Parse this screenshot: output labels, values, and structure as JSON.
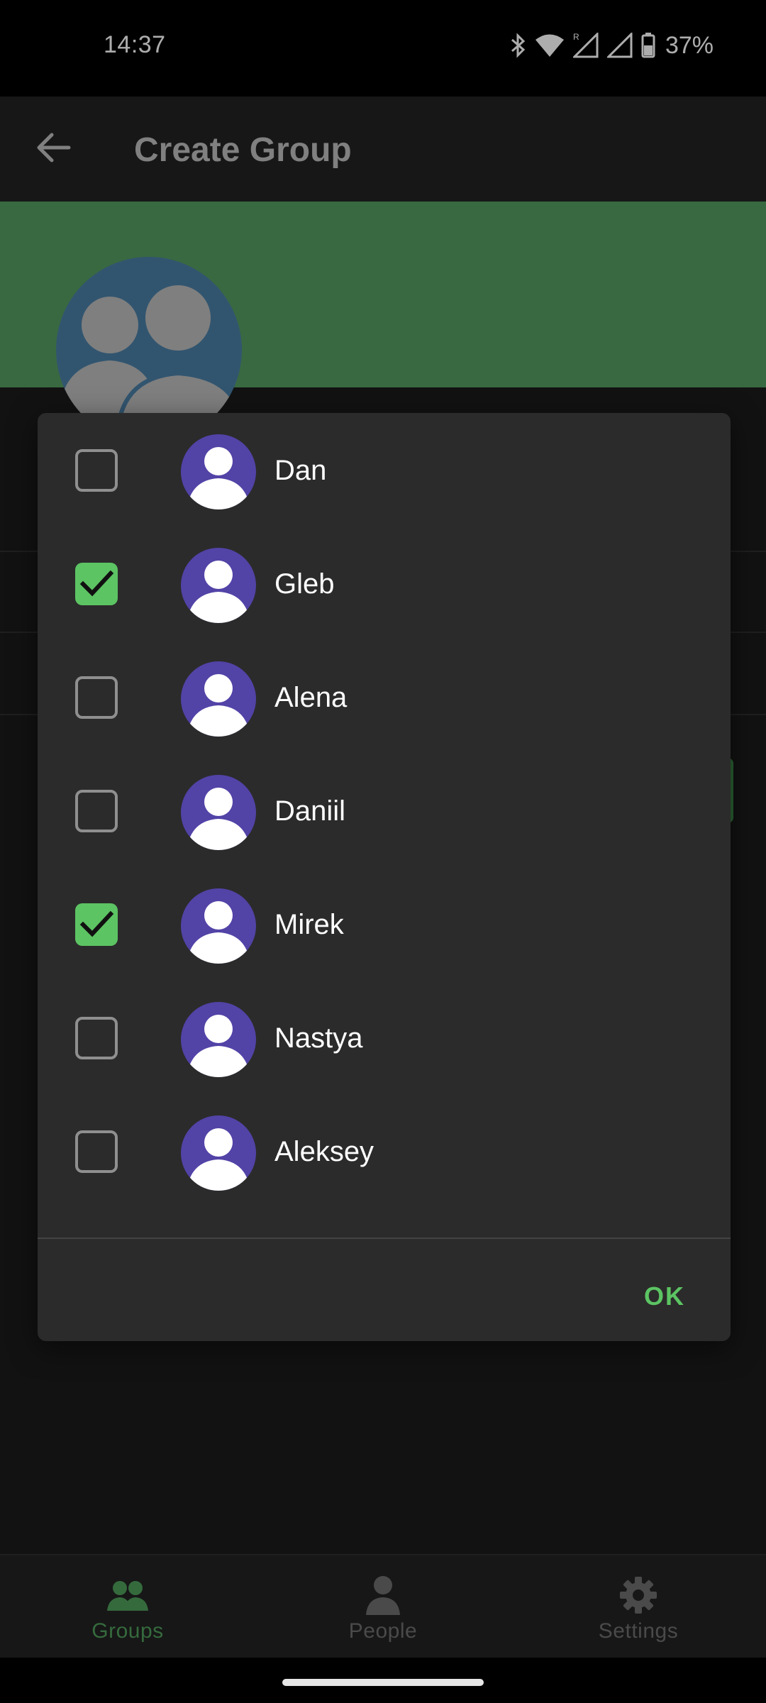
{
  "status_bar": {
    "time": "14:37",
    "battery": "37%",
    "icons": [
      "bluetooth-icon",
      "wifi-icon",
      "signal-icon",
      "signal-icon",
      "battery-icon"
    ]
  },
  "app_bar": {
    "title": "Create Group",
    "back_icon": "arrow-back-icon"
  },
  "header": {
    "color": "#549b60",
    "avatar_color": "#4a7ea4"
  },
  "dialog": {
    "members": [
      {
        "name": "Dan",
        "checked": false
      },
      {
        "name": "Gleb",
        "checked": true
      },
      {
        "name": "Alena",
        "checked": false
      },
      {
        "name": "Daniil",
        "checked": false
      },
      {
        "name": "Mirek",
        "checked": true
      },
      {
        "name": "Nastya",
        "checked": false
      },
      {
        "name": "Aleksey",
        "checked": false
      }
    ],
    "ok_label": "OK",
    "accent": "#5cc463",
    "avatar_color": "#5243a7"
  },
  "bottom_nav": {
    "items": [
      {
        "label": "Groups",
        "icon": "groups-icon",
        "active": true
      },
      {
        "label": "People",
        "icon": "person-icon",
        "active": false
      },
      {
        "label": "Settings",
        "icon": "gear-icon",
        "active": false
      }
    ],
    "active_color": "#4f9c5a"
  }
}
